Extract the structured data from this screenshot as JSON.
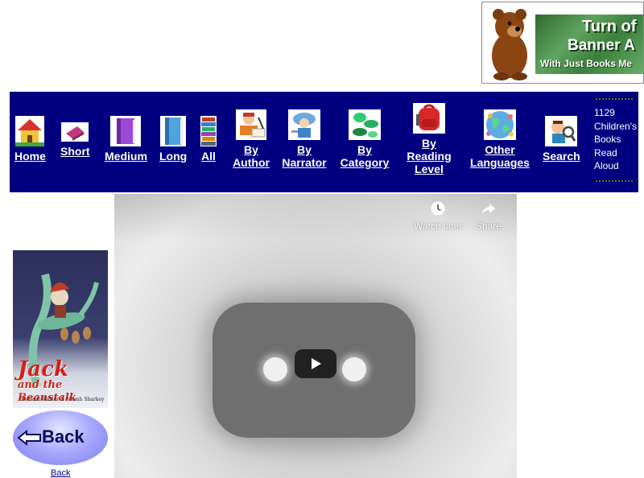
{
  "banner": {
    "line1": "Turn of",
    "line2": "Banner A",
    "line3": "With Just Books Me"
  },
  "nav": {
    "items": [
      {
        "label": "Home",
        "icon": "house-icon"
      },
      {
        "label": "Short",
        "icon": "small-book-icon"
      },
      {
        "label": "Medium",
        "icon": "purple-book-icon"
      },
      {
        "label": "Long",
        "icon": "blue-book-icon"
      },
      {
        "label": "All",
        "icon": "book-stack-icon"
      },
      {
        "label": "By Author",
        "icon": "author-writing-icon"
      },
      {
        "label": "By Narrator",
        "icon": "narrator-icon"
      },
      {
        "label": "By Category",
        "icon": "animals-icon"
      },
      {
        "label": "By Reading Level",
        "icon": "backpack-icon"
      },
      {
        "label": "Other Languages",
        "icon": "globe-icon"
      },
      {
        "label": "Search",
        "icon": "magnifier-kid-icon"
      }
    ],
    "count_text": "1129 Children's Books Read Aloud"
  },
  "video": {
    "watch_later": "Watch later",
    "share": "Share"
  },
  "cover": {
    "title_line1": "Jack",
    "title_line2": "and the Beanstalk",
    "authors": "Richard Walker & Niamh Sharkey"
  },
  "back": {
    "button_label": "Back",
    "link_label": "Back"
  }
}
